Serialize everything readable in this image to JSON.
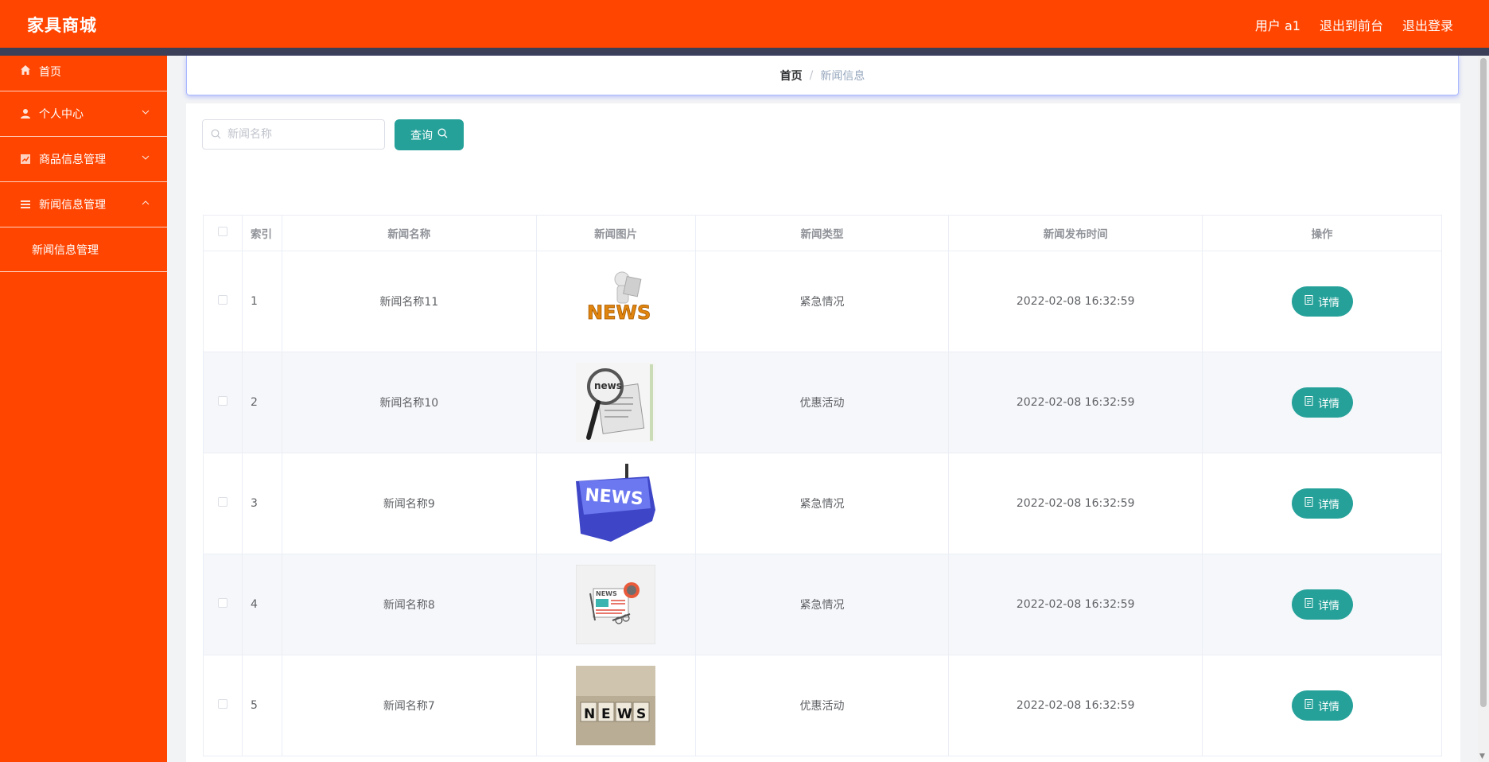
{
  "header": {
    "brand": "家具商城",
    "user": "用户 a1",
    "to_front": "退出到前台",
    "logout": "退出登录"
  },
  "sidebar": {
    "items": [
      {
        "label": "首页",
        "icon": "home-icon"
      },
      {
        "label": "个人中心",
        "icon": "user-icon"
      },
      {
        "label": "商品信息管理",
        "icon": "chart-icon"
      },
      {
        "label": "新闻信息管理",
        "icon": "list-icon"
      }
    ],
    "sub_item": "新闻信息管理"
  },
  "breadcrumb": {
    "home": "首页",
    "separator": "/",
    "current": "新闻信息"
  },
  "search": {
    "placeholder": "新闻名称",
    "button_label": "查询"
  },
  "table": {
    "headers": [
      "索引",
      "新闻名称",
      "新闻图片",
      "新闻类型",
      "新闻发布时间",
      "操作"
    ],
    "action_label": "详情",
    "rows": [
      {
        "index": "1",
        "name": "新闻名称11",
        "type": "紧急情况",
        "time": "2022-02-08 16:32:59",
        "image": "news-figure-thumbnail"
      },
      {
        "index": "2",
        "name": "新闻名称10",
        "type": "优惠活动",
        "time": "2022-02-08 16:32:59",
        "image": "news-magnifier-thumbnail"
      },
      {
        "index": "3",
        "name": "新闻名称9",
        "type": "紧急情况",
        "time": "2022-02-08 16:32:59",
        "image": "news-key-thumbnail"
      },
      {
        "index": "4",
        "name": "新闻名称8",
        "type": "紧急情况",
        "time": "2022-02-08 16:32:59",
        "image": "news-flat-thumbnail"
      },
      {
        "index": "5",
        "name": "新闻名称7",
        "type": "优惠活动",
        "time": "2022-02-08 16:32:59",
        "image": "news-blocks-thumbnail"
      }
    ]
  },
  "colors": {
    "primary": "#ff4500",
    "accent": "#26a19a",
    "strip": "#3b3f58"
  }
}
